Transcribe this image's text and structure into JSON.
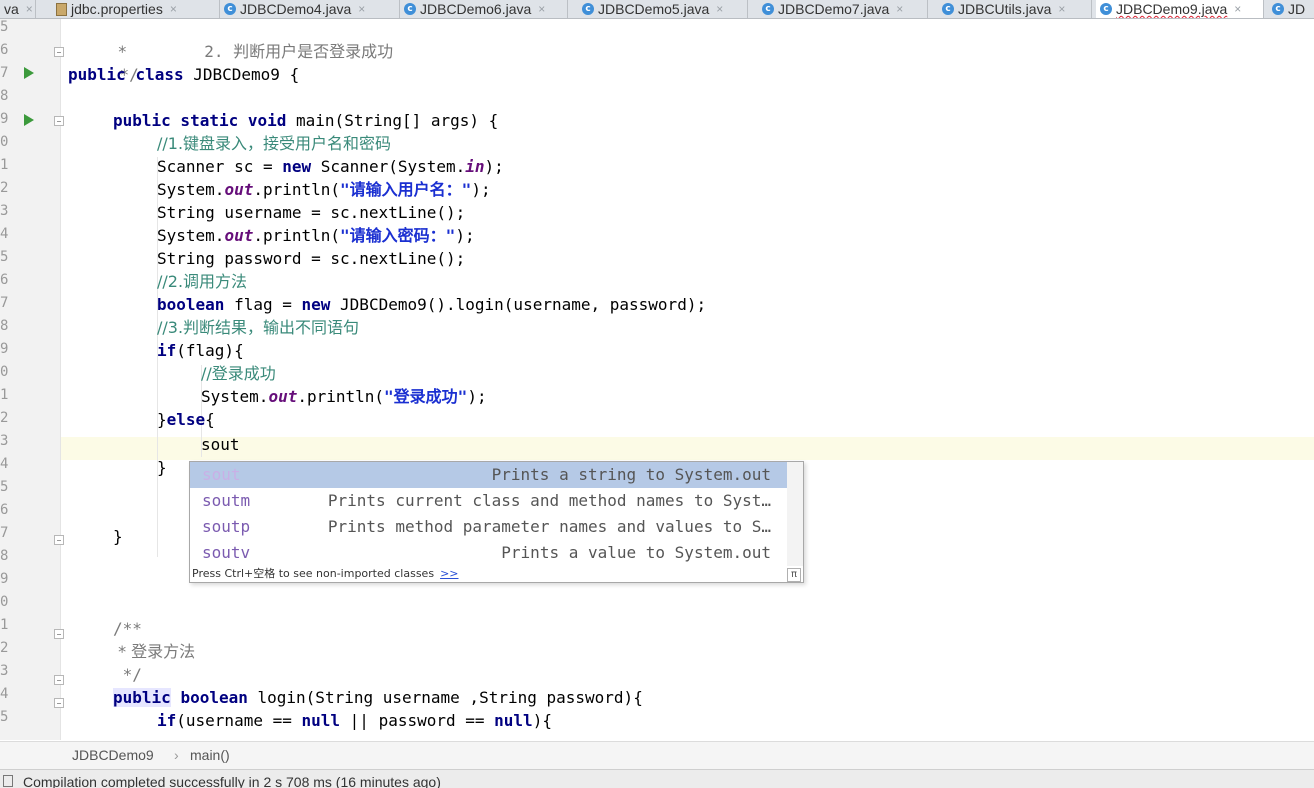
{
  "tabs": [
    {
      "label": "va",
      "type": "partial"
    },
    {
      "label": "jdbc.properties",
      "type": "file"
    },
    {
      "label": "JDBCDemo4.java",
      "type": "class"
    },
    {
      "label": "JDBCDemo6.java",
      "type": "class"
    },
    {
      "label": "JDBCDemo5.java",
      "type": "class"
    },
    {
      "label": "JDBCDemo7.java",
      "type": "class"
    },
    {
      "label": "JDBCUtils.java",
      "type": "class"
    },
    {
      "label": "JDBCDemo9.java",
      "type": "class",
      "active": true
    },
    {
      "label": "JD",
      "type": "class"
    }
  ],
  "gutter": {
    "line_numbers": [
      "5",
      "6",
      "7",
      "8",
      "9",
      "0",
      "1",
      "2",
      "3",
      "4",
      "5",
      "6",
      "7",
      "8",
      "9",
      "0",
      "1",
      "2",
      "3",
      "4",
      "5",
      "6",
      "7",
      "8",
      "9",
      "0",
      "1",
      "2",
      "3",
      "4",
      "5"
    ]
  },
  "code": {
    "l5_comment": "*        2. 判断用户是否登录成功",
    "l6_comment_end": "*/",
    "l7_public": "public",
    "l7_class": "class",
    "l7_name": " JDBCDemo9 {",
    "l9_kw": "public static void",
    "l9_rest": " main(String[] args) {",
    "l10_comment": "//1.键盘录入，接受用户名和密码",
    "l11_a": "Scanner sc = ",
    "l11_new": "new",
    "l11_b": " Scanner(System.",
    "l11_in": "in",
    "l11_c": ");",
    "l12_a": "System.",
    "l12_out": "out",
    "l12_b": ".println(",
    "l12_str": "\"请输入用户名：\"",
    "l12_c": ");",
    "l13": "String username = sc.nextLine();",
    "l14_a": "System.",
    "l14_out": "out",
    "l14_b": ".println(",
    "l14_str": "\"请输入密码：\"",
    "l14_c": ");",
    "l15": "String password = sc.nextLine();",
    "l16_comment": "//2.调用方法",
    "l17_bool": "boolean",
    "l17_a": " flag = ",
    "l17_new": "new",
    "l17_b": " JDBCDemo9().login(username, password);",
    "l18_comment": "//3.判断结果，输出不同语句",
    "l19_if": "if",
    "l19_rest": "(flag){",
    "l20_comment": "//登录成功",
    "l21_a": "System.",
    "l21_out": "out",
    "l21_b": ".println(",
    "l21_str": "\"登录成功\"",
    "l21_c": ");",
    "l22_a": "}",
    "l22_else": "else",
    "l22_b": "{",
    "l23": "sout",
    "l24": "}",
    "l27": "}",
    "l31_doc": "/**",
    "l32_doc": " * 登录方法",
    "l33_doc": " */",
    "l34_public": "public",
    "l34_boolean": "boolean",
    "l34_rest": " login(String username ,String password){",
    "l35_if": "if",
    "l35_a": "(username == ",
    "l35_null1": "null",
    "l35_b": " || password == ",
    "l35_null2": "null",
    "l35_c": "){"
  },
  "autocomplete": {
    "items": [
      {
        "key": "sout",
        "desc": "Prints a string to System.out",
        "selected": true
      },
      {
        "key": "soutm",
        "desc": "Prints current class and method names to Syst…"
      },
      {
        "key": "soutp",
        "desc": "Prints method parameter names and values to S…"
      },
      {
        "key": "soutv",
        "desc": "Prints a value to System.out"
      }
    ],
    "footer_text": "Press Ctrl+空格 to see non-imported classes",
    "footer_link": ">>",
    "pi": "π"
  },
  "breadcrumb": {
    "class": "JDBCDemo9",
    "separator": "›",
    "method": "main()"
  },
  "status": {
    "message": "Compilation completed successfully in 2 s 708 ms (16 minutes ago)"
  },
  "colors": {
    "keyword": "#000080",
    "comment": "#3a8a7a",
    "string": "#1a2fd1",
    "static_field": "#660e7a",
    "current_line": "#fcfbe6",
    "popup_selection": "#b5c9e6"
  }
}
